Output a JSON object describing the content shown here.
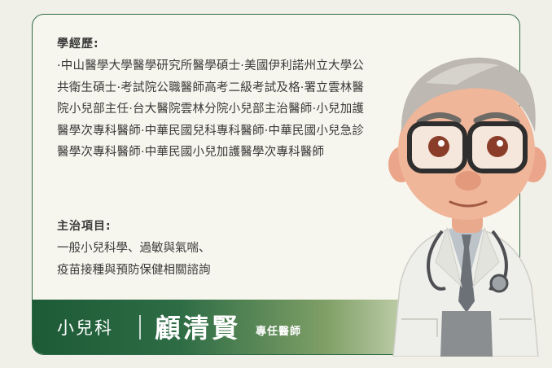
{
  "profile": {
    "education_title": "學經歷:",
    "education_text": "·中山醫學大學醫學研究所醫學碩士·美國伊利諾州立大學公共衛生碩士·考試院公職醫師高考二級考試及格·署立雲林醫院小兒部主任·台大醫院雲林分院小兒部主治醫師·小兒加護醫學次專科醫師·中華民國兒科專科醫師·中華民國小兒急診醫學次專科醫師·中華民國小兒加護醫學次專科醫師",
    "specialty_title": "主治項目:",
    "specialties": [
      "一般小兒科學、過敏與氣喘、",
      "疫苗接種與預防保健相關諮詢"
    ]
  },
  "footer": {
    "department": "小兒科",
    "doctor_name": "顧清賢",
    "doctor_role": "專任醫師"
  },
  "avatar": {
    "icon": "doctor-avatar-illustration"
  },
  "colors": {
    "brand_green": "#1d5a36",
    "card_border": "#2f6a46",
    "text": "#3a3a3a"
  }
}
